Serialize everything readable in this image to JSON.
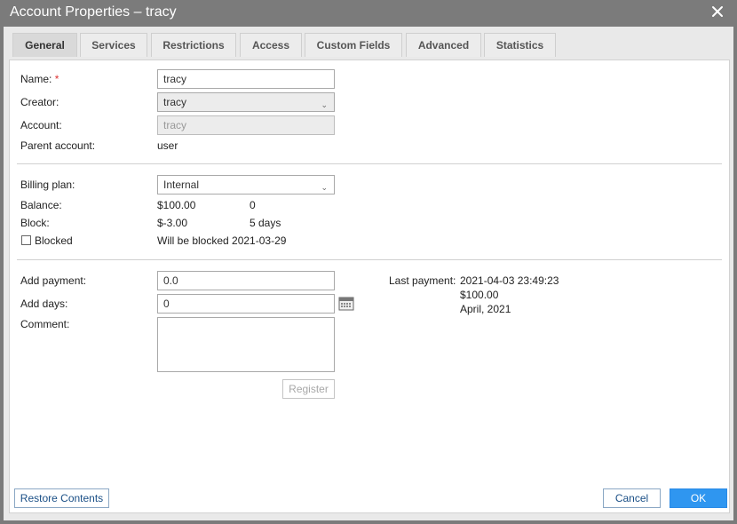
{
  "window": {
    "title": "Account Properties – tracy"
  },
  "tabs": [
    {
      "label": "General"
    },
    {
      "label": "Services"
    },
    {
      "label": "Restrictions"
    },
    {
      "label": "Access"
    },
    {
      "label": "Custom Fields"
    },
    {
      "label": "Advanced"
    },
    {
      "label": "Statistics"
    }
  ],
  "general": {
    "name_label": "Name:",
    "name_required": "*",
    "name_value": "tracy",
    "creator_label": "Creator:",
    "creator_value": "tracy",
    "account_label": "Account:",
    "account_value": "tracy",
    "parent_label": "Parent account:",
    "parent_value": "user"
  },
  "billing": {
    "plan_label": "Billing plan:",
    "plan_value": "Internal",
    "balance_label": "Balance:",
    "balance_value": "$100.00",
    "balance_extra": "0",
    "block_label": "Block:",
    "block_value": "$-3.00",
    "block_days": "5 days",
    "blocked_label": "Blocked",
    "blocked_checked": false,
    "blocked_note": "Will be blocked 2021-03-29"
  },
  "payment": {
    "add_payment_label": "Add payment:",
    "add_payment_value": "0.0",
    "add_days_label": "Add days:",
    "add_days_value": "0",
    "comment_label": "Comment:",
    "register_label": "Register",
    "last_payment_label": "Last payment:",
    "last_payment_date": "2021-04-03 23:49:23",
    "last_payment_amount": "$100.00",
    "last_payment_period": "April, 2021"
  },
  "footer": {
    "restore_label": "Restore Contents",
    "cancel_label": "Cancel",
    "ok_label": "OK"
  },
  "colors": {
    "titlebar": "#7b7b7b",
    "ok_button": "#2f96f0",
    "required": "#dd3333"
  },
  "icons": {
    "close": "close-icon",
    "calendar": "calendar-icon",
    "chevron": "chevron-down-icon"
  }
}
